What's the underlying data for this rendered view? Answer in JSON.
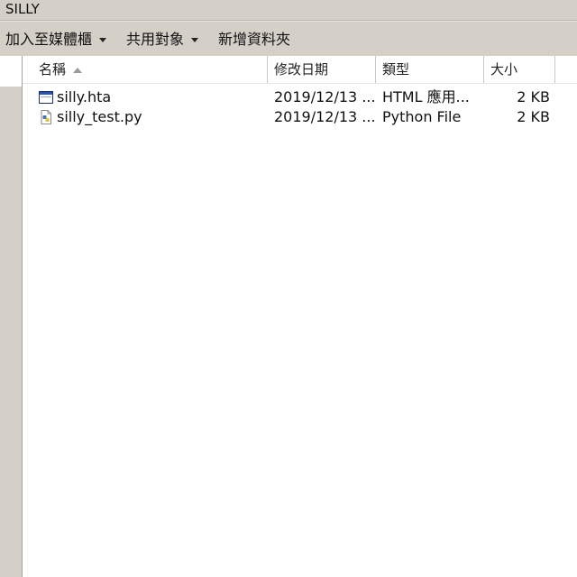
{
  "window": {
    "title": "SILLY"
  },
  "toolbar": {
    "add_to_library": "加入至媒體櫃",
    "share_with": "共用對象",
    "new_folder": "新增資料夾"
  },
  "columns": {
    "name": "名稱",
    "date_modified": "修改日期",
    "type": "類型",
    "size": "大小"
  },
  "files": [
    {
      "name": "silly.hta",
      "date": "2019/12/13 ...",
      "type": "HTML 應用...",
      "size": "2 KB",
      "icon": "hta-file-icon"
    },
    {
      "name": "silly_test.py",
      "date": "2019/12/13 ...",
      "type": "Python File",
      "size": "2 KB",
      "icon": "python-file-icon"
    }
  ]
}
